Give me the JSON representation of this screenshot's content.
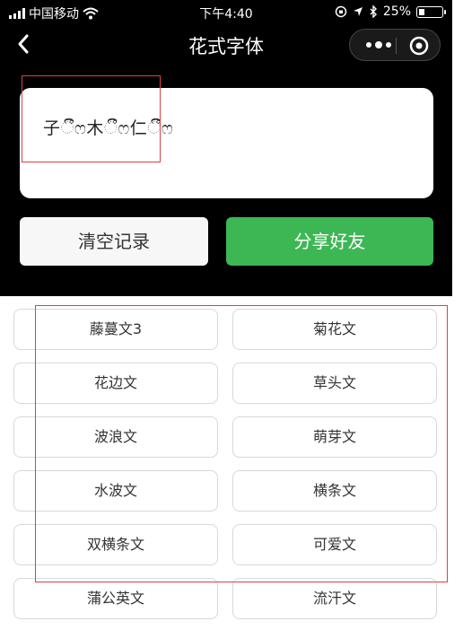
{
  "status": {
    "carrier": "中国移动",
    "time": "下午4:40",
    "battery": "25%"
  },
  "nav": {
    "title": "花式字体"
  },
  "output": {
    "text": "子ීීෆ木ීීෆ仁ීීෆ"
  },
  "actions": {
    "clear_label": "清空记录",
    "share_label": "分享好友"
  },
  "styles": [
    "藤蔓文3",
    "菊花文",
    "花边文",
    "草头文",
    "波浪文",
    "萌芽文",
    "水波文",
    "横条文",
    "双横条文",
    "可爱文",
    "蒲公英文",
    "流汗文"
  ],
  "colors": {
    "share_button": "#3cb754",
    "annotation": "#e04040"
  }
}
